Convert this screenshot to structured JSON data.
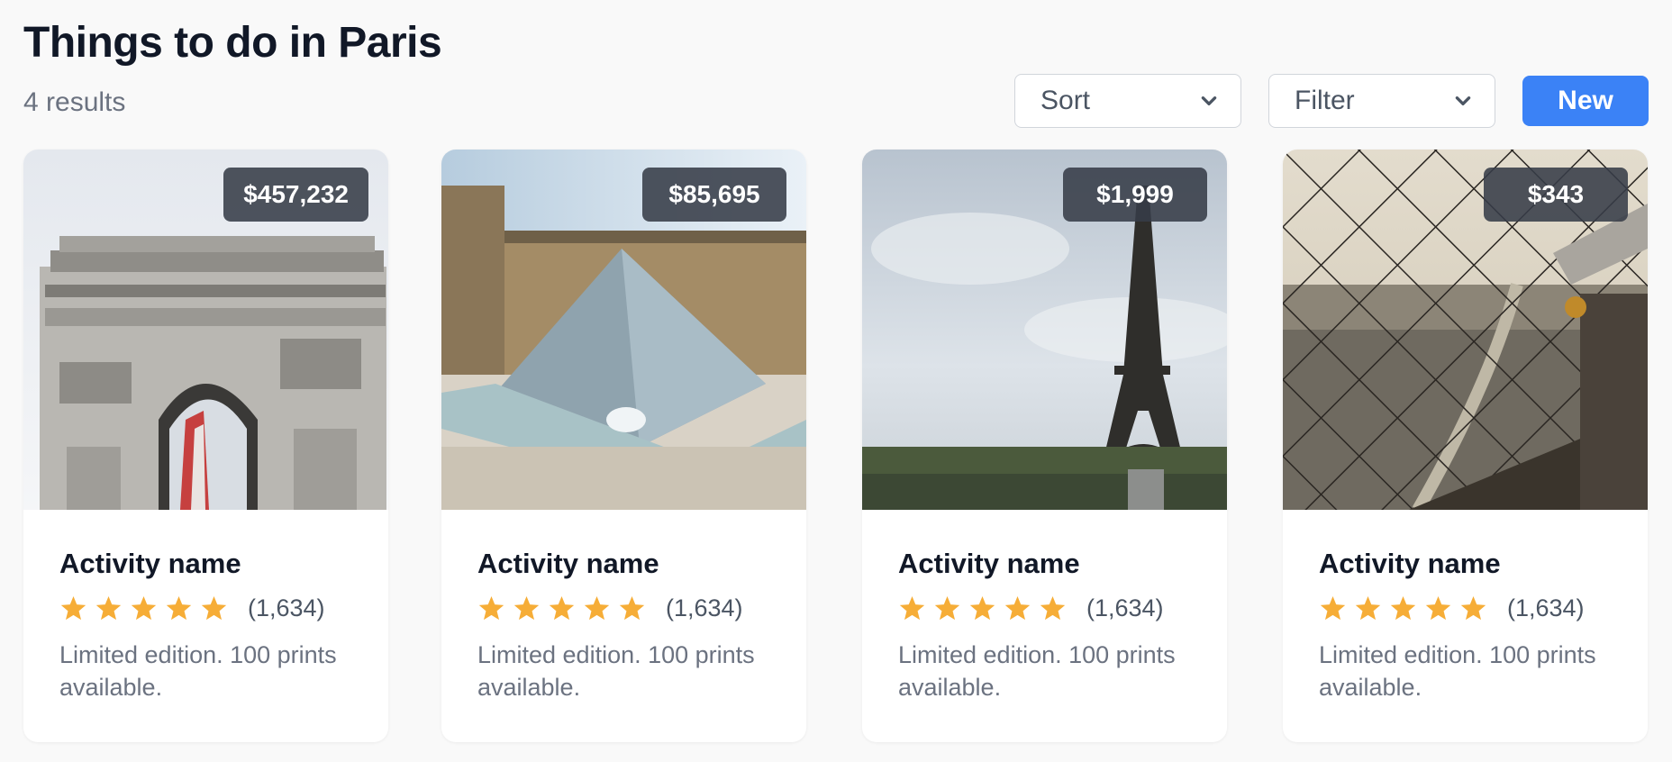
{
  "header": {
    "title": "Things to do in Paris",
    "result_count": "4 results"
  },
  "toolbar": {
    "sort_label": "Sort",
    "filter_label": "Filter",
    "new_label": "New",
    "accent_color": "#3b82f6"
  },
  "cards": [
    {
      "price": "$457,232",
      "name": "Activity name",
      "rating": 5,
      "reviews": "(1,634)",
      "description": "Limited edition. 100 prints available.",
      "image": "arc-de-triomphe-photo"
    },
    {
      "price": "$85,695",
      "name": "Activity name",
      "rating": 5,
      "reviews": "(1,634)",
      "description": "Limited edition. 100 prints available.",
      "image": "louvre-pyramid-photo"
    },
    {
      "price": "$1,999",
      "name": "Activity name",
      "rating": 5,
      "reviews": "(1,634)",
      "description": "Limited edition. 100 prints available.",
      "image": "eiffel-tower-photo"
    },
    {
      "price": "$343",
      "name": "Activity name",
      "rating": 5,
      "reviews": "(1,634)",
      "description": "Limited edition. 100 prints available.",
      "image": "eiffel-tower-view-photo"
    }
  ],
  "icons": {
    "star": "star-icon",
    "chevron": "chevron-down-icon"
  },
  "colors": {
    "star": "#f6ad37",
    "price_badge": "#373c48"
  }
}
